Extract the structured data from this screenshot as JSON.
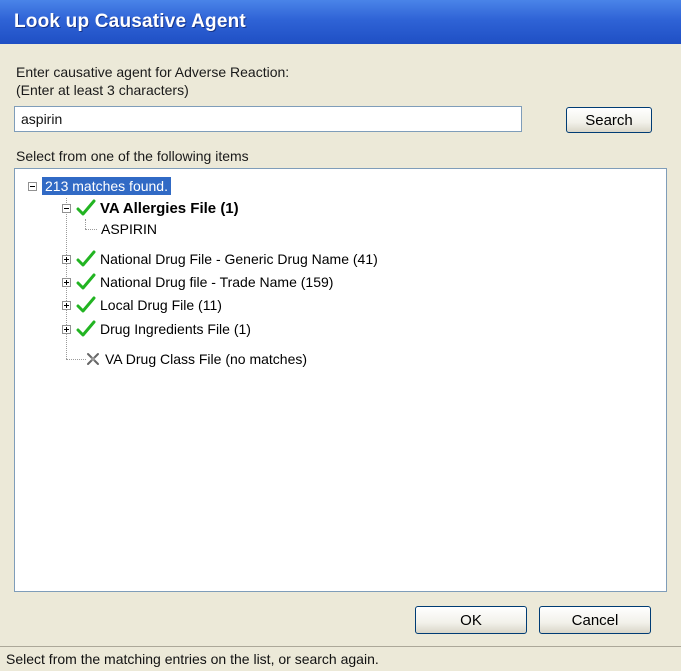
{
  "window": {
    "title": "Look up Causative Agent"
  },
  "form": {
    "prompt_line1": "Enter causative agent for Adverse Reaction:",
    "prompt_line2": "(Enter at least 3 characters)",
    "search_value": "aspirin",
    "search_button": "Search",
    "list_label": "Select from one of the following items"
  },
  "tree": {
    "root": "213 matches found.",
    "items": [
      {
        "label": "VA Allergies File  (1)",
        "status": "match",
        "expanded": true,
        "children": [
          "ASPIRIN"
        ]
      },
      {
        "label": "National Drug File - Generic Drug Name  (41)",
        "status": "match",
        "expanded": false
      },
      {
        "label": "National Drug file - Trade Name  (159)",
        "status": "match",
        "expanded": false
      },
      {
        "label": "Local Drug File  (11)",
        "status": "match",
        "expanded": false
      },
      {
        "label": "Drug Ingredients File  (1)",
        "status": "match",
        "expanded": false
      },
      {
        "label": "VA Drug Class File  (no matches)",
        "status": "no-match",
        "expanded": false
      }
    ]
  },
  "buttons": {
    "ok": "OK",
    "cancel": "Cancel"
  },
  "status_bar": "Select from the matching entries on the list, or search again.",
  "colors": {
    "check": "#22b422",
    "selection": "#316ac5",
    "titlebar": "#2f63d6"
  }
}
